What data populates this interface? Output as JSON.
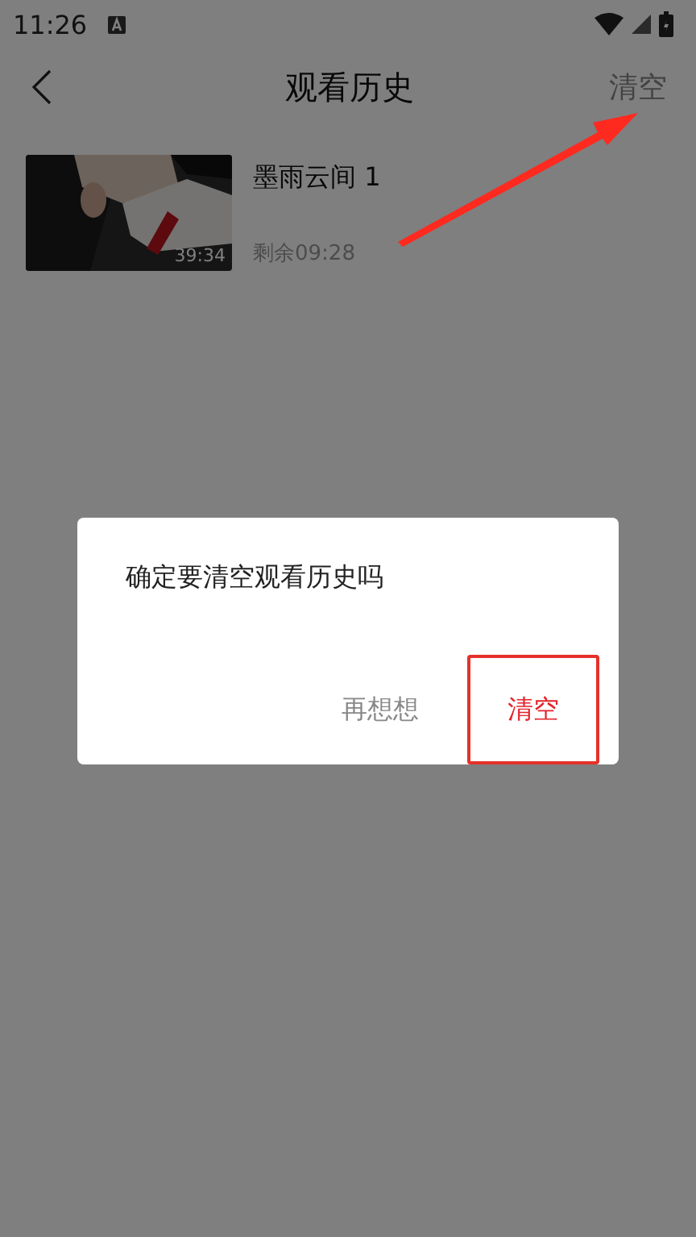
{
  "status_bar": {
    "time": "11:26"
  },
  "header": {
    "title": "观看历史",
    "clear": "清空"
  },
  "history": [
    {
      "title": "墨雨云间 1",
      "duration": "39:34",
      "remaining": "剩余09:28"
    }
  ],
  "dialog": {
    "message": "确定要清空观看历史吗",
    "buttons": [
      {
        "label": "再想想",
        "kind": "cancel",
        "highlighted": false
      },
      {
        "label": "清空",
        "kind": "confirm",
        "highlighted": true
      }
    ]
  },
  "annotation": {
    "arrow": true
  }
}
